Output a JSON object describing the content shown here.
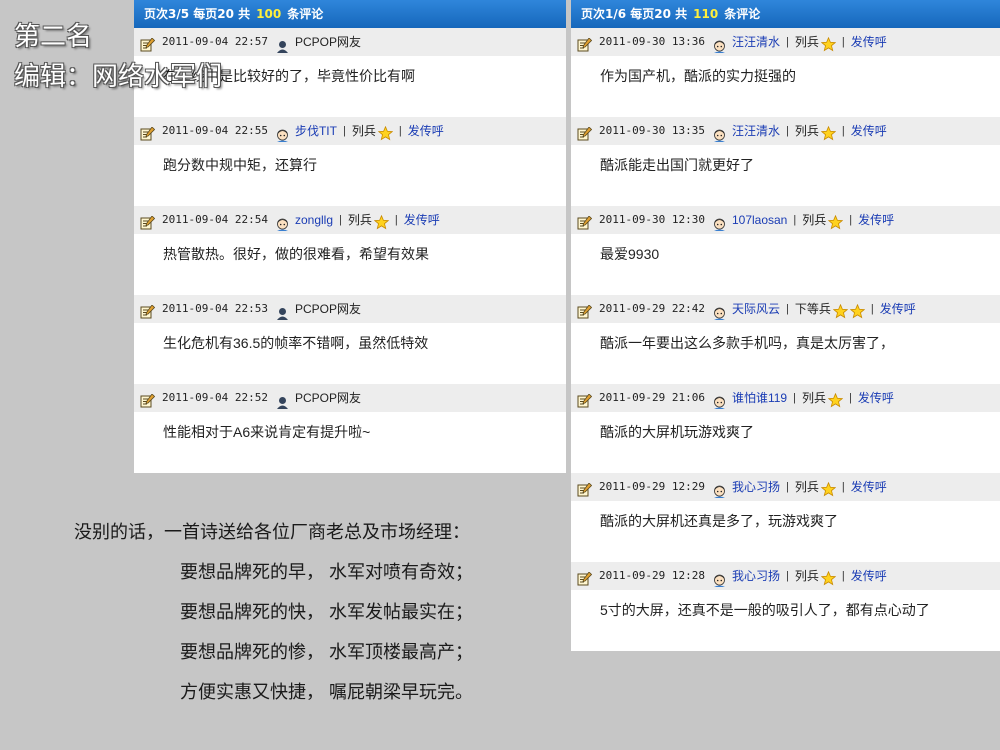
{
  "overlay": {
    "rank_heading": "第二名",
    "editor_heading": "编辑：网络水军们"
  },
  "left_panel": {
    "pager": {
      "prefix": "页次3/5 每页20 共",
      "count": "100",
      "suffix": "条评论"
    },
    "comments": [
      {
        "time": "2011-09-04 22:57",
        "user": "PCPOP网友",
        "registered": false,
        "rank": "",
        "stars": 0,
        "forward": "",
        "text": "在二线中是比较好的了，毕竟性价比有啊"
      },
      {
        "time": "2011-09-04 22:55",
        "user": "步伐TIT",
        "registered": true,
        "rank": "列兵",
        "stars": 1,
        "forward": "发传呼",
        "text": "跑分数中规中矩，还算行"
      },
      {
        "time": "2011-09-04 22:54",
        "user": "zongllg",
        "registered": true,
        "rank": "列兵",
        "stars": 1,
        "forward": "发传呼",
        "text": "热管散热。很好，做的很难看，希望有效果"
      },
      {
        "time": "2011-09-04 22:53",
        "user": "PCPOP网友",
        "registered": false,
        "rank": "",
        "stars": 0,
        "forward": "",
        "text": "生化危机有36.5的帧率不错啊，虽然低特效"
      },
      {
        "time": "2011-09-04 22:52",
        "user": "PCPOP网友",
        "registered": false,
        "rank": "",
        "stars": 0,
        "forward": "",
        "text": "性能相对于A6来说肯定有提升啦~"
      }
    ]
  },
  "right_panel": {
    "pager": {
      "prefix": "页次1/6 每页20 共",
      "count": "110",
      "suffix": "条评论"
    },
    "comments": [
      {
        "time": "2011-09-30 13:36",
        "user": "汪汪清水",
        "registered": true,
        "rank": "列兵",
        "stars": 1,
        "forward": "发传呼",
        "text": "作为国产机，酷派的实力挺强的"
      },
      {
        "time": "2011-09-30 13:35",
        "user": "汪汪清水",
        "registered": true,
        "rank": "列兵",
        "stars": 1,
        "forward": "发传呼",
        "text": "酷派能走出国门就更好了"
      },
      {
        "time": "2011-09-30 12:30",
        "user": "107laosan",
        "registered": true,
        "rank": "列兵",
        "stars": 1,
        "forward": "发传呼",
        "text": "最爱9930"
      },
      {
        "time": "2011-09-29 22:42",
        "user": "天际风云",
        "registered": true,
        "rank": "下等兵",
        "stars": 2,
        "forward": "发传呼",
        "text": "酷派一年要出这么多款手机吗，真是太厉害了，"
      },
      {
        "time": "2011-09-29 21:06",
        "user": "谁怕谁119",
        "registered": true,
        "rank": "列兵",
        "stars": 1,
        "forward": "发传呼",
        "text": "酷派的大屏机玩游戏爽了"
      },
      {
        "time": "2011-09-29 12:29",
        "user": "我心习扬",
        "registered": true,
        "rank": "列兵",
        "stars": 1,
        "forward": "发传呼",
        "text": "酷派的大屏机还真是多了，玩游戏爽了"
      },
      {
        "time": "2011-09-29 12:28",
        "user": "我心习扬",
        "registered": true,
        "rank": "列兵",
        "stars": 1,
        "forward": "发传呼",
        "text": "5寸的大屏，还真不是一般的吸引人了，都有点心动了"
      }
    ]
  },
  "poem": {
    "intro": "没别的话，一首诗送给各位厂商老总及市场经理：",
    "lines": [
      "要想品牌死的早， 水军对喷有奇效；",
      "要想品牌死的快， 水军发帖最实在；",
      "要想品牌死的惨， 水军顶楼最高产；",
      "方便实惠又快捷， 嘱屁朝梁早玩完。"
    ]
  },
  "colors": {
    "pager_bg": "#1e74c9",
    "count_highlight": "#ffef3c",
    "link": "#1a3cb4",
    "meta_bg": "#ededed",
    "page_bg": "#c6c6c6"
  },
  "icons": {
    "edit": "edit-note-icon",
    "guest_avatar": "guest-avatar-icon",
    "member_avatar": "member-avatar-icon",
    "rank_star": "star-icon"
  }
}
